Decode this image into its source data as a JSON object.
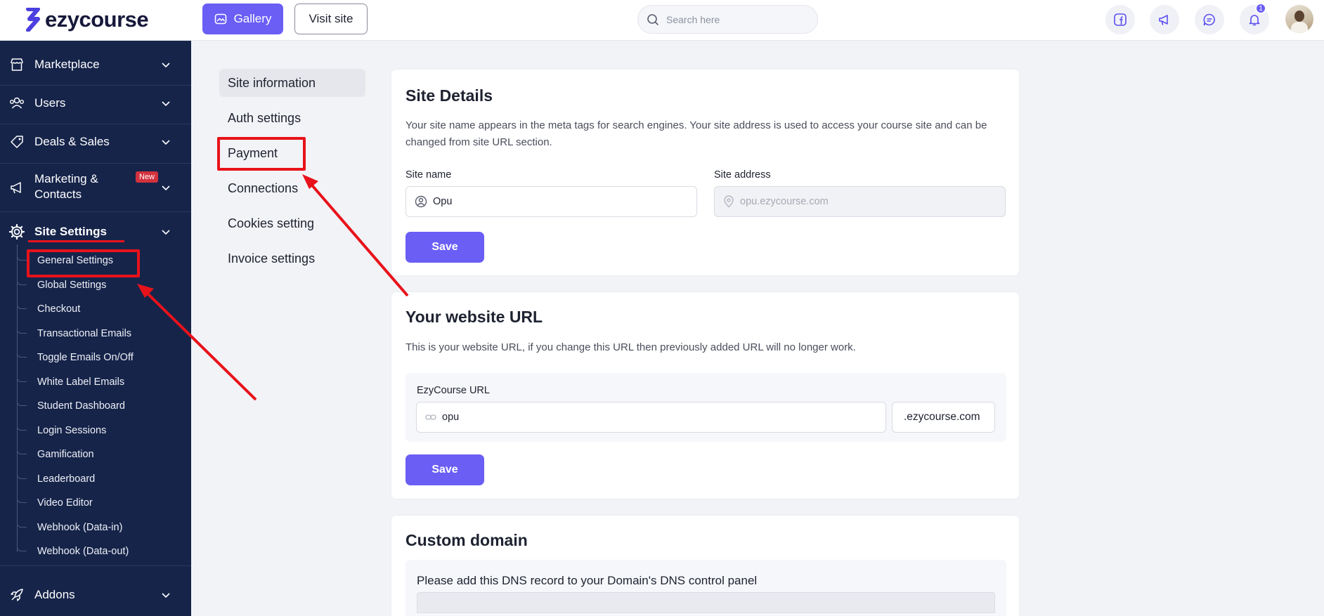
{
  "app": {
    "brand": "ezycourse"
  },
  "topbar": {
    "gallery_label": "Gallery",
    "visit_site_label": "Visit site",
    "search_placeholder": "Search here",
    "notification_count": "1",
    "icons": [
      "facebook-icon",
      "megaphone-icon",
      "chat-icon",
      "bell-icon"
    ]
  },
  "sidebar": {
    "items": [
      {
        "label": "Marketplace",
        "icon": "store-icon"
      },
      {
        "label": "Users",
        "icon": "users-icon"
      },
      {
        "label": "Deals & Sales",
        "icon": "tag-icon"
      },
      {
        "label": "Marketing & Contacts",
        "label_line1": "Marketing &",
        "label_line2": "Contacts",
        "badge": "New",
        "icon": "megaphone-icon"
      },
      {
        "label": "Site Settings",
        "icon": "gear-icon"
      },
      {
        "label": "Addons",
        "icon": "rocket-icon"
      }
    ],
    "site_settings_children": [
      "General Settings",
      "Global Settings",
      "Checkout",
      "Transactional Emails",
      "Toggle Emails On/Off",
      "White Label Emails",
      "Student Dashboard",
      "Login Sessions",
      "Gamification",
      "Leaderboard",
      "Video Editor",
      "Webhook (Data-in)",
      "Webhook (Data-out)"
    ]
  },
  "settings_nav": {
    "items": [
      "Site information",
      "Auth settings",
      "Payment",
      "Connections",
      "Cookies setting",
      "Invoice settings"
    ],
    "active": "Site information"
  },
  "site_details": {
    "title": "Site Details",
    "description": "Your site name appears in the meta tags for search engines. Your site address is used to access your course site and can be changed from site URL section.",
    "site_name_label": "Site name",
    "site_name_value": "Opu",
    "site_address_label": "Site address",
    "site_address_value": "opu.ezycourse.com",
    "save_label": "Save"
  },
  "website_url": {
    "title": "Your website URL",
    "description": "This is your website URL, if you change this URL then previously added URL will no longer work.",
    "field_label": "EzyCourse URL",
    "subdomain_value": "opu",
    "suffix": ".ezycourse.com",
    "save_label": "Save"
  },
  "custom_domain": {
    "title": "Custom domain",
    "instruction": "Please add this DNS record to your Domain's DNS control panel"
  },
  "colors": {
    "sidebar_bg": "#16244a",
    "accent": "#6a5ef5",
    "annotation_red": "#e8121a",
    "new_badge": "#d2323e"
  }
}
